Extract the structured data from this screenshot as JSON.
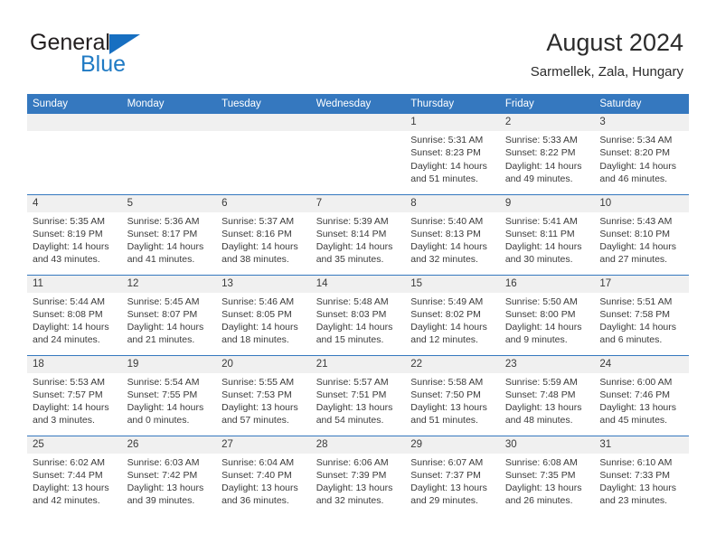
{
  "brand": {
    "name_part1": "General",
    "name_part2": "Blue",
    "flag_icon": "triangle-flag-icon"
  },
  "header": {
    "title": "August 2024",
    "subtitle": "Sarmellek, Zala, Hungary"
  },
  "colors": {
    "header_blue": "#3578bf",
    "brand_blue": "#1f7ac4",
    "daynum_bg": "#f0f0f0",
    "text": "#3a3a3a"
  },
  "weekday_headers": [
    "Sunday",
    "Monday",
    "Tuesday",
    "Wednesday",
    "Thursday",
    "Friday",
    "Saturday"
  ],
  "weeks": [
    [
      {
        "day": "",
        "empty": true
      },
      {
        "day": "",
        "empty": true
      },
      {
        "day": "",
        "empty": true
      },
      {
        "day": "",
        "empty": true
      },
      {
        "day": "1",
        "sunrise": "Sunrise: 5:31 AM",
        "sunset": "Sunset: 8:23 PM",
        "daylight": "Daylight: 14 hours and 51 minutes."
      },
      {
        "day": "2",
        "sunrise": "Sunrise: 5:33 AM",
        "sunset": "Sunset: 8:22 PM",
        "daylight": "Daylight: 14 hours and 49 minutes."
      },
      {
        "day": "3",
        "sunrise": "Sunrise: 5:34 AM",
        "sunset": "Sunset: 8:20 PM",
        "daylight": "Daylight: 14 hours and 46 minutes."
      }
    ],
    [
      {
        "day": "4",
        "sunrise": "Sunrise: 5:35 AM",
        "sunset": "Sunset: 8:19 PM",
        "daylight": "Daylight: 14 hours and 43 minutes."
      },
      {
        "day": "5",
        "sunrise": "Sunrise: 5:36 AM",
        "sunset": "Sunset: 8:17 PM",
        "daylight": "Daylight: 14 hours and 41 minutes."
      },
      {
        "day": "6",
        "sunrise": "Sunrise: 5:37 AM",
        "sunset": "Sunset: 8:16 PM",
        "daylight": "Daylight: 14 hours and 38 minutes."
      },
      {
        "day": "7",
        "sunrise": "Sunrise: 5:39 AM",
        "sunset": "Sunset: 8:14 PM",
        "daylight": "Daylight: 14 hours and 35 minutes."
      },
      {
        "day": "8",
        "sunrise": "Sunrise: 5:40 AM",
        "sunset": "Sunset: 8:13 PM",
        "daylight": "Daylight: 14 hours and 32 minutes."
      },
      {
        "day": "9",
        "sunrise": "Sunrise: 5:41 AM",
        "sunset": "Sunset: 8:11 PM",
        "daylight": "Daylight: 14 hours and 30 minutes."
      },
      {
        "day": "10",
        "sunrise": "Sunrise: 5:43 AM",
        "sunset": "Sunset: 8:10 PM",
        "daylight": "Daylight: 14 hours and 27 minutes."
      }
    ],
    [
      {
        "day": "11",
        "sunrise": "Sunrise: 5:44 AM",
        "sunset": "Sunset: 8:08 PM",
        "daylight": "Daylight: 14 hours and 24 minutes."
      },
      {
        "day": "12",
        "sunrise": "Sunrise: 5:45 AM",
        "sunset": "Sunset: 8:07 PM",
        "daylight": "Daylight: 14 hours and 21 minutes."
      },
      {
        "day": "13",
        "sunrise": "Sunrise: 5:46 AM",
        "sunset": "Sunset: 8:05 PM",
        "daylight": "Daylight: 14 hours and 18 minutes."
      },
      {
        "day": "14",
        "sunrise": "Sunrise: 5:48 AM",
        "sunset": "Sunset: 8:03 PM",
        "daylight": "Daylight: 14 hours and 15 minutes."
      },
      {
        "day": "15",
        "sunrise": "Sunrise: 5:49 AM",
        "sunset": "Sunset: 8:02 PM",
        "daylight": "Daylight: 14 hours and 12 minutes."
      },
      {
        "day": "16",
        "sunrise": "Sunrise: 5:50 AM",
        "sunset": "Sunset: 8:00 PM",
        "daylight": "Daylight: 14 hours and 9 minutes."
      },
      {
        "day": "17",
        "sunrise": "Sunrise: 5:51 AM",
        "sunset": "Sunset: 7:58 PM",
        "daylight": "Daylight: 14 hours and 6 minutes."
      }
    ],
    [
      {
        "day": "18",
        "sunrise": "Sunrise: 5:53 AM",
        "sunset": "Sunset: 7:57 PM",
        "daylight": "Daylight: 14 hours and 3 minutes."
      },
      {
        "day": "19",
        "sunrise": "Sunrise: 5:54 AM",
        "sunset": "Sunset: 7:55 PM",
        "daylight": "Daylight: 14 hours and 0 minutes."
      },
      {
        "day": "20",
        "sunrise": "Sunrise: 5:55 AM",
        "sunset": "Sunset: 7:53 PM",
        "daylight": "Daylight: 13 hours and 57 minutes."
      },
      {
        "day": "21",
        "sunrise": "Sunrise: 5:57 AM",
        "sunset": "Sunset: 7:51 PM",
        "daylight": "Daylight: 13 hours and 54 minutes."
      },
      {
        "day": "22",
        "sunrise": "Sunrise: 5:58 AM",
        "sunset": "Sunset: 7:50 PM",
        "daylight": "Daylight: 13 hours and 51 minutes."
      },
      {
        "day": "23",
        "sunrise": "Sunrise: 5:59 AM",
        "sunset": "Sunset: 7:48 PM",
        "daylight": "Daylight: 13 hours and 48 minutes."
      },
      {
        "day": "24",
        "sunrise": "Sunrise: 6:00 AM",
        "sunset": "Sunset: 7:46 PM",
        "daylight": "Daylight: 13 hours and 45 minutes."
      }
    ],
    [
      {
        "day": "25",
        "sunrise": "Sunrise: 6:02 AM",
        "sunset": "Sunset: 7:44 PM",
        "daylight": "Daylight: 13 hours and 42 minutes."
      },
      {
        "day": "26",
        "sunrise": "Sunrise: 6:03 AM",
        "sunset": "Sunset: 7:42 PM",
        "daylight": "Daylight: 13 hours and 39 minutes."
      },
      {
        "day": "27",
        "sunrise": "Sunrise: 6:04 AM",
        "sunset": "Sunset: 7:40 PM",
        "daylight": "Daylight: 13 hours and 36 minutes."
      },
      {
        "day": "28",
        "sunrise": "Sunrise: 6:06 AM",
        "sunset": "Sunset: 7:39 PM",
        "daylight": "Daylight: 13 hours and 32 minutes."
      },
      {
        "day": "29",
        "sunrise": "Sunrise: 6:07 AM",
        "sunset": "Sunset: 7:37 PM",
        "daylight": "Daylight: 13 hours and 29 minutes."
      },
      {
        "day": "30",
        "sunrise": "Sunrise: 6:08 AM",
        "sunset": "Sunset: 7:35 PM",
        "daylight": "Daylight: 13 hours and 26 minutes."
      },
      {
        "day": "31",
        "sunrise": "Sunrise: 6:10 AM",
        "sunset": "Sunset: 7:33 PM",
        "daylight": "Daylight: 13 hours and 23 minutes."
      }
    ]
  ]
}
